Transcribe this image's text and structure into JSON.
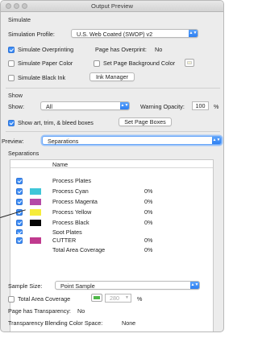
{
  "window": {
    "title": "Output Preview"
  },
  "simulate": {
    "section_label": "Simulate",
    "profile_label": "Simulation Profile:",
    "profile_value": "U.S. Web Coated (SWOP) v2",
    "simulate_overprinting": {
      "label": "Simulate Overprinting",
      "checked": true
    },
    "page_has_overprint_label": "Page has Overprint:",
    "page_has_overprint_value": "No",
    "simulate_paper_color": {
      "label": "Simulate Paper Color",
      "checked": false
    },
    "set_page_background_color": {
      "label": "Set Page Background Color",
      "checked": false
    },
    "simulate_black_ink": {
      "label": "Simulate Black Ink",
      "checked": false
    },
    "ink_manager_label": "Ink Manager"
  },
  "show": {
    "section_label": "Show",
    "show_label": "Show:",
    "show_value": "All",
    "warning_opacity_label": "Warning Opacity:",
    "warning_opacity_value": "100",
    "warning_opacity_unit": "%",
    "show_boxes": {
      "label": "Show art, trim, & bleed boxes",
      "checked": true
    },
    "set_page_boxes_label": "Set Page Boxes"
  },
  "preview": {
    "label": "Preview:",
    "value": "Separations"
  },
  "separations": {
    "section_label": "Separations",
    "column_name": "Name",
    "rows": [
      {
        "name": "Process Plates",
        "pct": "",
        "checked": true,
        "color": ""
      },
      {
        "name": "Process Cyan",
        "pct": "0%",
        "checked": true,
        "color": "#3fc6d8"
      },
      {
        "name": "Process Magenta",
        "pct": "0%",
        "checked": true,
        "color": "#b44aa7"
      },
      {
        "name": "Process Yellow",
        "pct": "0%",
        "checked": true,
        "color": "#f6ec3a"
      },
      {
        "name": "Process Black",
        "pct": "0%",
        "checked": true,
        "color": "#050505"
      },
      {
        "name": "Spot Plates",
        "pct": "",
        "checked": true,
        "color": ""
      },
      {
        "name": "CUTTER",
        "pct": "0%",
        "checked": true,
        "color": "#c03a8e"
      },
      {
        "name": "Total Area Coverage",
        "pct": "0%",
        "checked": false,
        "color": ""
      }
    ]
  },
  "sample": {
    "label": "Sample Size:",
    "value": "Point Sample"
  },
  "coverage": {
    "label": "Total Area Coverage",
    "checked": false,
    "color": "#4fb84a",
    "value": "280",
    "unit": "%"
  },
  "transparency": {
    "page_has_transparency_label": "Page has Transparency:",
    "page_has_transparency_value": "No",
    "blending_space_label": "Transparency Blending Color Space:",
    "blending_space_value": "None"
  }
}
